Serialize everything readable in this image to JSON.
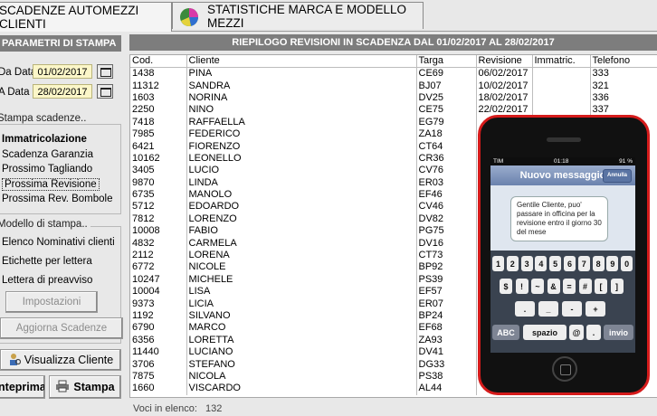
{
  "tabs": [
    {
      "label": "SCADENZE AUTOMEZZI CLIENTI",
      "active": true
    },
    {
      "label": "STATISTICHE MARCA E MODELLO MEZZI",
      "active": false,
      "icon": "pie-chart-icon"
    }
  ],
  "print_params": {
    "header": "PARAMETRI DI STAMPA",
    "from_label": "Da Data",
    "from_value": "01/02/2017",
    "to_label": "A Data",
    "to_value": "28/02/2017"
  },
  "print_deadlines": {
    "title": "Stampa scadenze..",
    "options": [
      "Immatricolazione",
      "Scadenza Garanzia",
      "Prossimo Tagliando",
      "Prossima Revisione",
      "Prossima Rev. Bombole"
    ],
    "selected": "Prossima Revisione"
  },
  "print_model": {
    "title": "Modello di stampa..",
    "options": [
      "Elenco Nominativi clienti",
      "Etichette per lettera",
      "Lettera di preavviso"
    ]
  },
  "buttons": {
    "settings": "Impostazioni",
    "update": "Aggiorna Scadenze",
    "view_client": "Visualizza Cliente",
    "preview": "Anteprima",
    "print": "Stampa"
  },
  "table": {
    "title": "RIEPILOGO REVISIONI IN SCADENZA DAL 01/02/2017 AL 28/02/2017",
    "columns": [
      "Cod.",
      "Cliente",
      "Targa",
      "Revisione",
      "Immatric.",
      "Telefono"
    ],
    "rows": [
      [
        "1438",
        "PINA",
        "CE69",
        "06/02/2017",
        "",
        "333"
      ],
      [
        "11312",
        "SANDRA",
        "BJ07",
        "10/02/2017",
        "",
        "321"
      ],
      [
        "1603",
        "NORINA",
        "DV25",
        "18/02/2017",
        "",
        "336"
      ],
      [
        "2250",
        "NINO",
        "CE75",
        "22/02/2017",
        "",
        "337"
      ],
      [
        "7418",
        "RAFFAELLA",
        "EG79",
        "",
        "",
        ""
      ],
      [
        "7985",
        "FEDERICO",
        "ZA18",
        "",
        "",
        ""
      ],
      [
        "6421",
        "FIORENZO",
        "CT64",
        "",
        "",
        ""
      ],
      [
        "10162",
        "LEONELLO",
        "CR36",
        "",
        "",
        ""
      ],
      [
        "3405",
        "LUCIO",
        "CV76",
        "",
        "",
        ""
      ],
      [
        "9870",
        "LINDA",
        "ER03",
        "",
        "",
        ""
      ],
      [
        "6735",
        "MANOLO",
        "EF46",
        "",
        "",
        ""
      ],
      [
        "5712",
        "EDOARDO",
        "CV46",
        "",
        "",
        ""
      ],
      [
        "7812",
        "LORENZO",
        "DV82",
        "",
        "",
        ""
      ],
      [
        "10008",
        "FABIO",
        "PG75",
        "",
        "",
        ""
      ],
      [
        "4832",
        "CARMELA",
        "DV16",
        "",
        "",
        ""
      ],
      [
        "2112",
        "LORENA",
        "CT73",
        "",
        "",
        ""
      ],
      [
        "6772",
        "NICOLE",
        "BP92",
        "",
        "",
        ""
      ],
      [
        "10247",
        "MICHELE",
        "PS39",
        "",
        "",
        ""
      ],
      [
        "10004",
        "LISA",
        "EF57",
        "",
        "",
        ""
      ],
      [
        "9373",
        "LICIA",
        "ER07",
        "",
        "",
        ""
      ],
      [
        "1192",
        "SILVANO",
        "BP24",
        "",
        "",
        ""
      ],
      [
        "6790",
        "MARCO",
        "EF68",
        "",
        "",
        ""
      ],
      [
        "6356",
        "LORETTA",
        "ZA93",
        "",
        "",
        ""
      ],
      [
        "11440",
        "LUCIANO",
        "DV41",
        "",
        "",
        ""
      ],
      [
        "3706",
        "STEFANO",
        "DG33",
        "",
        "",
        ""
      ],
      [
        "7875",
        "NICOLA",
        "PS38",
        "",
        "",
        ""
      ],
      [
        "1660",
        "VISCARDO",
        "AL44",
        "",
        "",
        ""
      ]
    ],
    "footer_label": "Voci in elenco:",
    "footer_count": "132"
  },
  "phone": {
    "carrier": "TIM",
    "time": "01:18",
    "battery": "91 %",
    "nav_title": "Nuovo messaggio",
    "cancel": "Annulla",
    "message": "Gentile Cliente, puo' passare in officina per la revisione entro il giorno 30 del mese",
    "keys_row1": [
      "1",
      "2",
      "3",
      "4",
      "5",
      "6",
      "7",
      "8",
      "9",
      "0"
    ],
    "keys_row2": [
      "$",
      "!",
      "~",
      "&",
      "=",
      "#",
      "[",
      "]"
    ],
    "keys_row3": [
      ".",
      "_",
      "-",
      "+"
    ],
    "key_abc": "ABC",
    "key_space": "spazio",
    "key_at": "@",
    "key_dot": ".",
    "key_send": "invio"
  },
  "colors": {
    "header_gray": "#7d7d7d",
    "date_bg": "#fbf6c8",
    "phone_border": "#d51b1b"
  }
}
